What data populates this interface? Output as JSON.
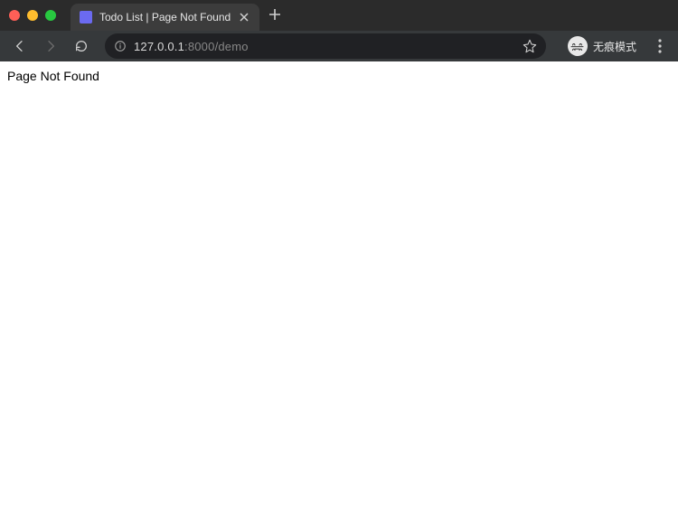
{
  "window": {
    "tabs": [
      {
        "title": "Todo List | Page Not Found"
      }
    ]
  },
  "toolbar": {
    "url_host": "127.0.0.1",
    "url_port": ":8000",
    "url_path": "/demo"
  },
  "profile": {
    "incognito_label": "无痕模式"
  },
  "page": {
    "body_text": "Page Not Found"
  }
}
